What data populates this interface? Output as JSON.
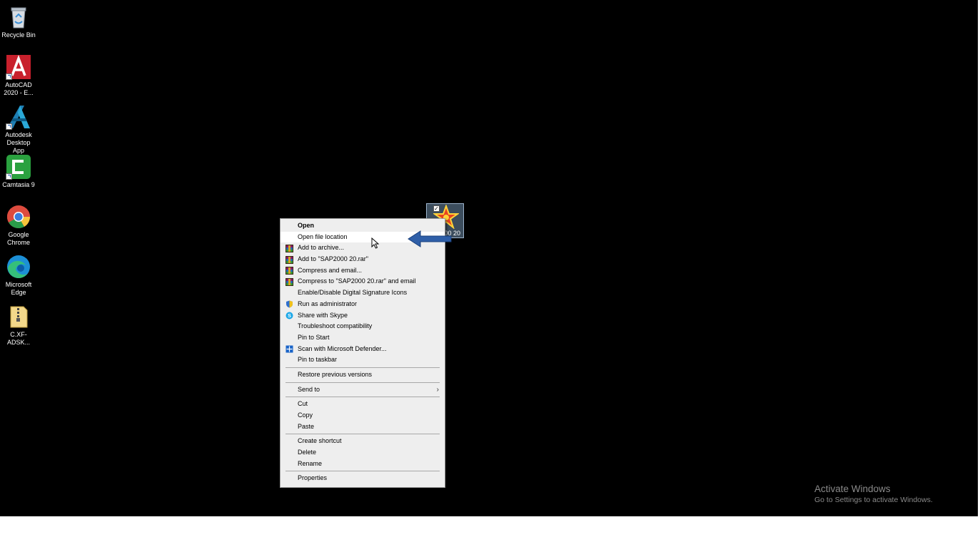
{
  "desktop": {
    "icons": [
      {
        "label": "Recycle Bin",
        "icon": "recycle-bin-icon"
      },
      {
        "label": "AutoCAD 2020 - E...",
        "icon": "autocad-icon"
      },
      {
        "label": "Autodesk Desktop App",
        "icon": "autodesk-icon"
      },
      {
        "label": "Camtasia 9",
        "icon": "camtasia-icon"
      },
      {
        "label": "Google Chrome",
        "icon": "chrome-icon"
      },
      {
        "label": "Microsoft Edge",
        "icon": "edge-icon"
      },
      {
        "label": "C.XF-ADSK...",
        "icon": "zip-folder-icon"
      }
    ],
    "selected_icon": {
      "caption": "00 20",
      "icon": "sap2000-icon"
    }
  },
  "context_menu": {
    "groups": [
      [
        {
          "label": "Open",
          "bold": true
        },
        {
          "label": "Open file location",
          "hover": true
        },
        {
          "label": "Add to archive...",
          "icon": "winrar-icon"
        },
        {
          "label": "Add to \"SAP2000 20.rar\"",
          "icon": "winrar-icon"
        },
        {
          "label": "Compress and email...",
          "icon": "winrar-icon"
        },
        {
          "label": "Compress to \"SAP2000 20.rar\" and email",
          "icon": "winrar-icon"
        },
        {
          "label": "Enable/Disable Digital Signature Icons"
        },
        {
          "label": "Run as administrator",
          "icon": "uac-shield-icon"
        },
        {
          "label": "Share with Skype",
          "icon": "skype-icon"
        },
        {
          "label": "Troubleshoot compatibility"
        },
        {
          "label": "Pin to Start"
        },
        {
          "label": "Scan with Microsoft Defender...",
          "icon": "defender-icon"
        },
        {
          "label": "Pin to taskbar"
        }
      ],
      [
        {
          "label": "Restore previous versions"
        }
      ],
      [
        {
          "label": "Send to",
          "submenu": true
        }
      ],
      [
        {
          "label": "Cut"
        },
        {
          "label": "Copy"
        },
        {
          "label": "Paste"
        }
      ],
      [
        {
          "label": "Create shortcut"
        },
        {
          "label": "Delete"
        },
        {
          "label": "Rename"
        }
      ],
      [
        {
          "label": "Properties"
        }
      ]
    ]
  },
  "watermark": {
    "title": "Activate Windows",
    "subtitle": "Go to Settings to activate Windows."
  },
  "colors": {
    "desktop_bg": "#000000",
    "menu_bg": "#eeeeee",
    "menu_hover": "#ffffff",
    "annotation_arrow": "#2f5fa8"
  }
}
